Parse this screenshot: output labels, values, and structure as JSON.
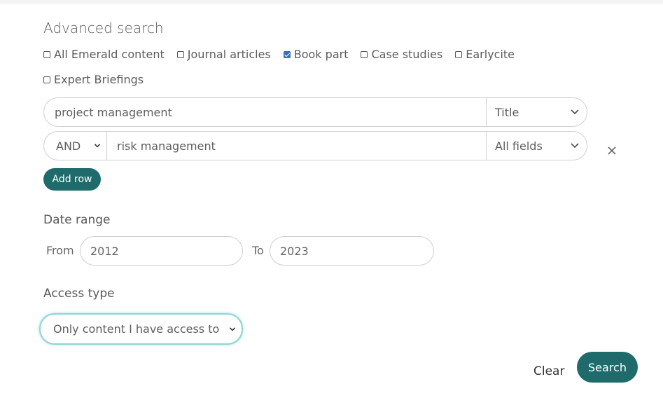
{
  "title": "Advanced search",
  "content_types": [
    {
      "label": "All Emerald content",
      "checked": false
    },
    {
      "label": "Journal articles",
      "checked": false
    },
    {
      "label": "Book part",
      "checked": true
    },
    {
      "label": "Case studies",
      "checked": false
    },
    {
      "label": "Earlycite",
      "checked": false
    },
    {
      "label": "Expert Briefings",
      "checked": false
    }
  ],
  "rows": [
    {
      "query": "project management",
      "field": "Title"
    },
    {
      "operator": "AND",
      "query": "risk management",
      "field": "All fields"
    }
  ],
  "add_row_label": "Add row",
  "date_range": {
    "label": "Date range",
    "from_label": "From",
    "from_value": "2012",
    "to_label": "To",
    "to_value": "2023"
  },
  "access_type": {
    "label": "Access type",
    "selected": "Only content I have access to"
  },
  "actions": {
    "clear_label": "Clear",
    "search_label": "Search"
  },
  "colors": {
    "accent": "#1f6b6b",
    "checkbox_checked": "#3b6fb6",
    "focus_ring": "#8fd3d6"
  }
}
